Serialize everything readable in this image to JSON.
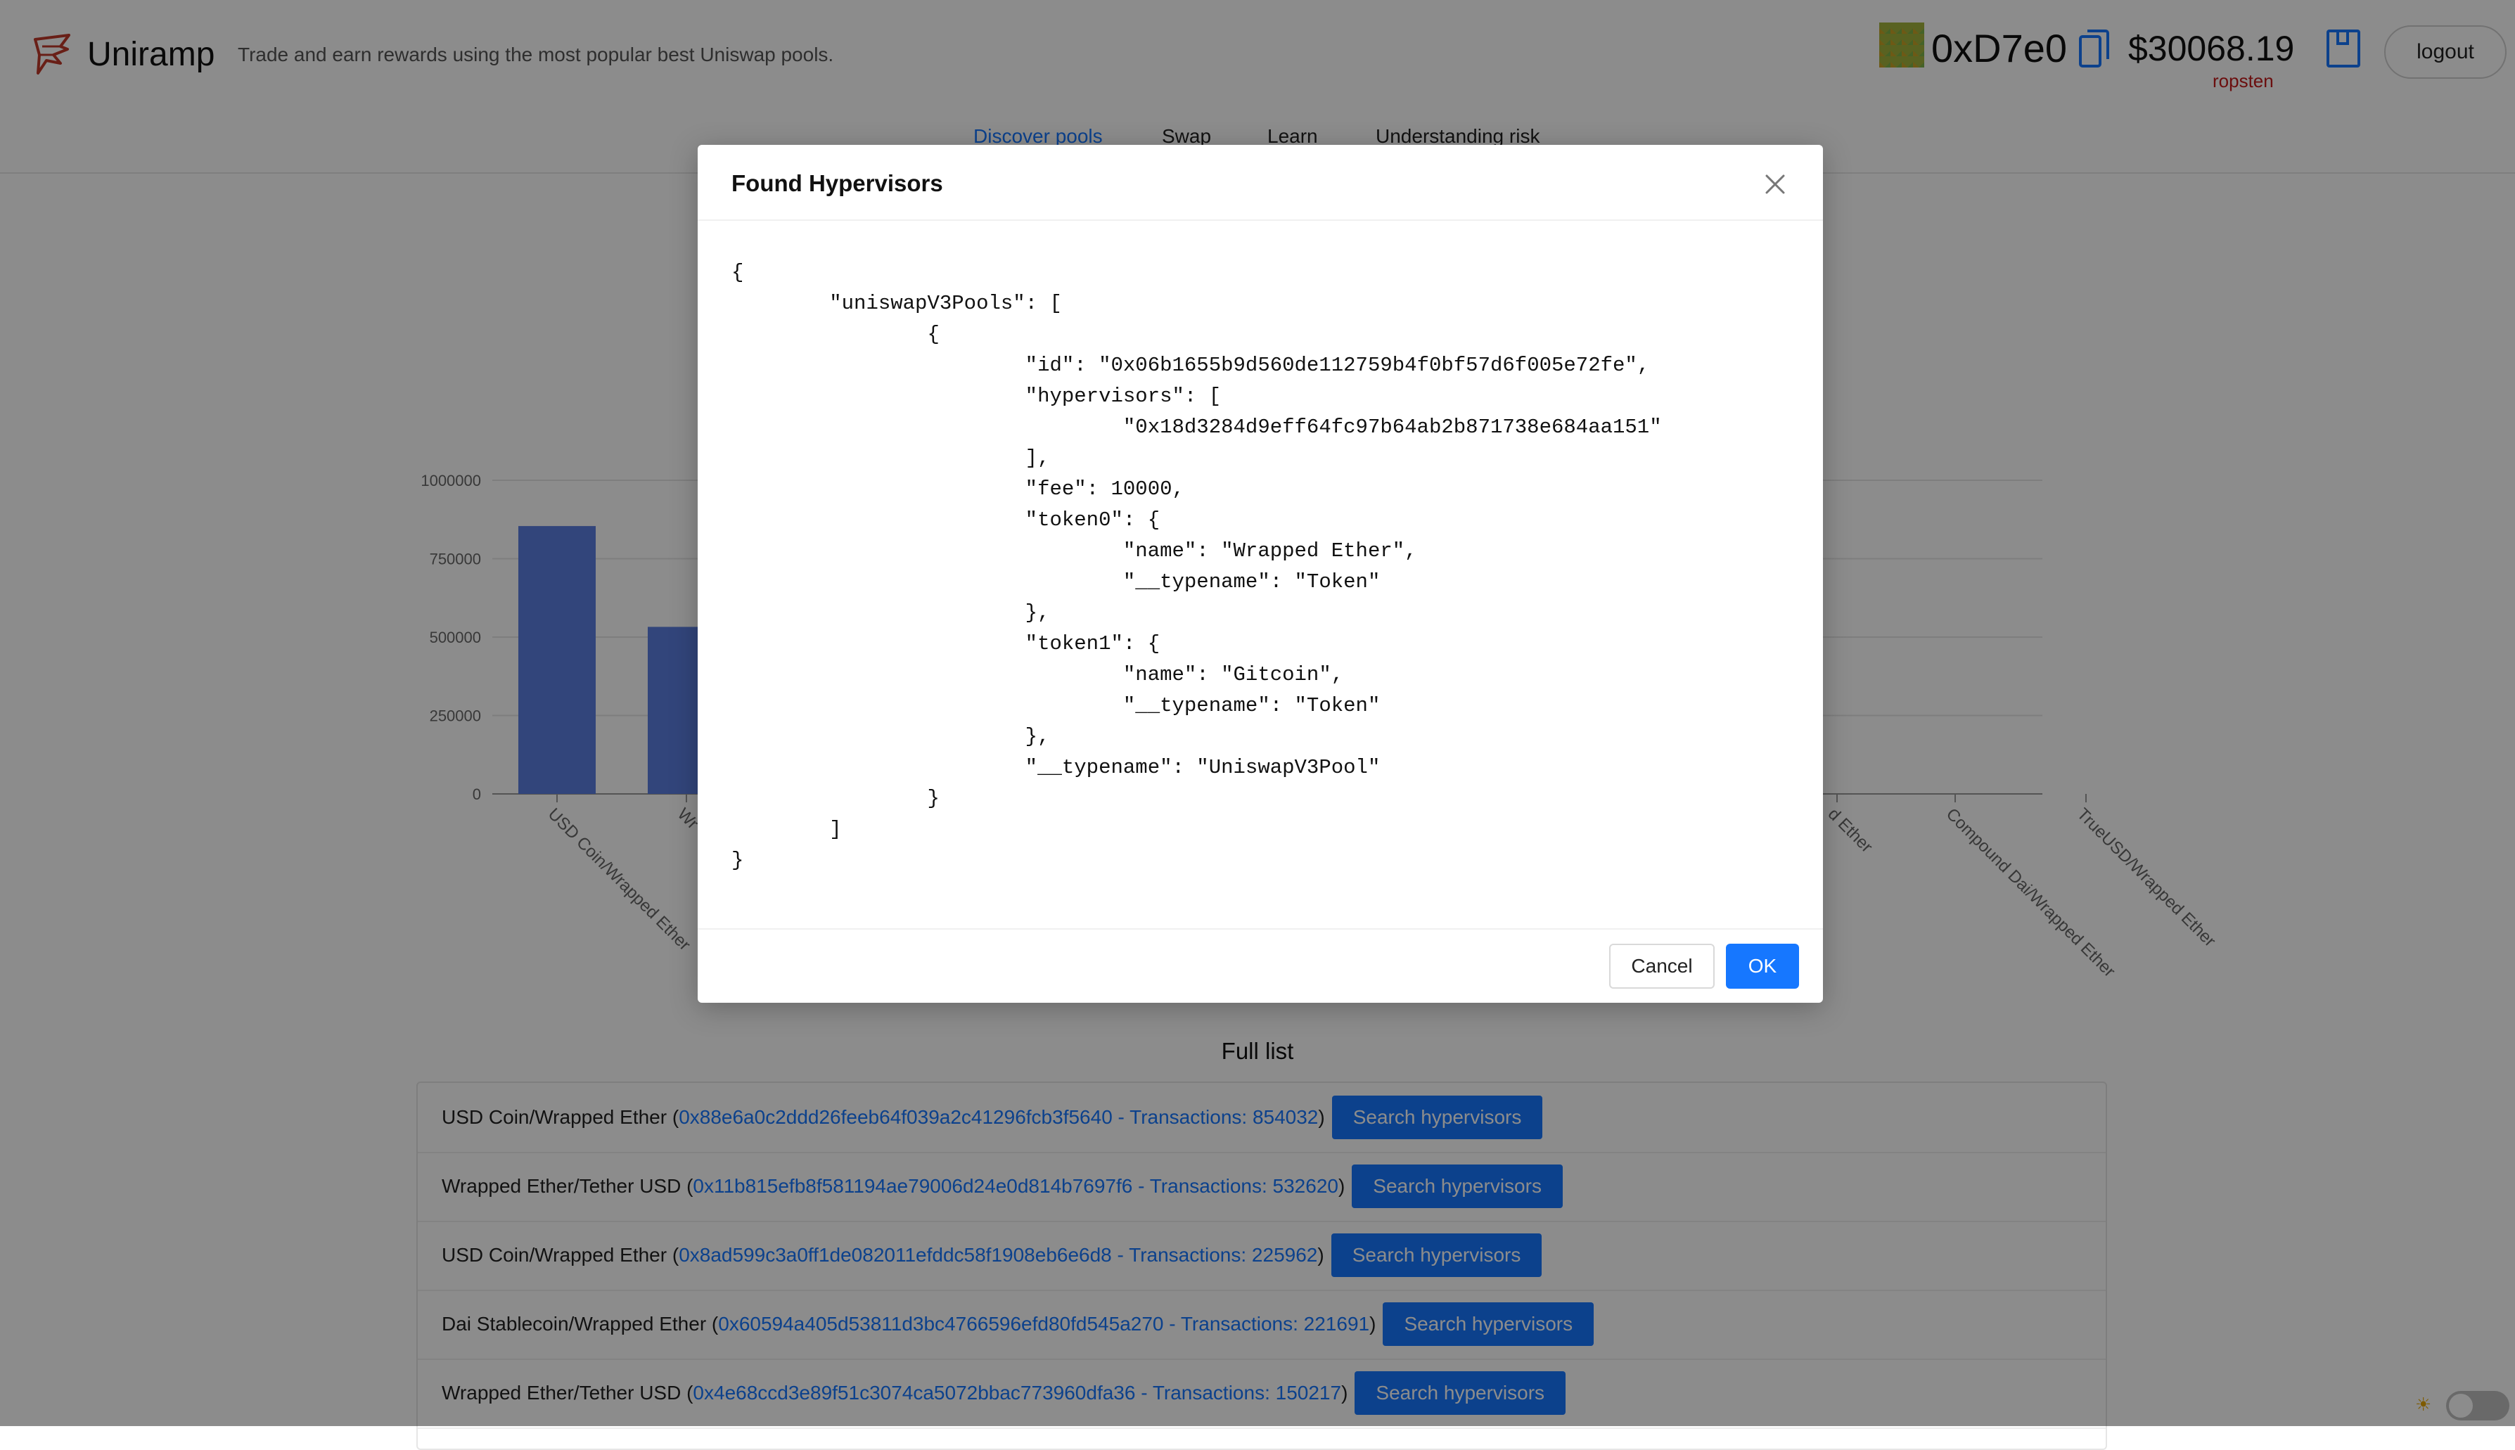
{
  "header": {
    "app_name": "Uniramp",
    "tagline": "Trade and earn rewards using the most popular best Uniswap pools.",
    "address": "0xD7e0",
    "balance": "$30068.19",
    "network": "ropsten",
    "logout_label": "logout",
    "nav": [
      {
        "label": "Discover pools",
        "active": true
      },
      {
        "label": "Swap",
        "active": false
      },
      {
        "label": "Learn",
        "active": false
      },
      {
        "label": "Understanding risk",
        "active": false
      }
    ]
  },
  "chart_data": {
    "type": "bar",
    "title": "",
    "xlabel": "",
    "ylabel": "",
    "ylim": [
      0,
      1000000
    ],
    "yticks": [
      "0",
      "250000",
      "500000",
      "750000",
      "1000000"
    ],
    "grid": true,
    "categories": [
      "USD Coin/Wrapped Ether",
      "Wr",
      "d Ether",
      "Compound Dai/Wrapped Ether",
      "TrueUSD/Wrapped Ether"
    ],
    "values": [
      854032,
      532620
    ]
  },
  "full_list": {
    "title": "Full list",
    "search_label": "Search hypervisors",
    "items": [
      {
        "name": "USD Coin/Wrapped Ether",
        "link": "0x88e6a0c2ddd26feeb64f039a2c41296fcb3f5640 - Transactions: 854032"
      },
      {
        "name": "Wrapped Ether/Tether USD",
        "link": "0x11b815efb8f581194ae79006d24e0d814b7697f6 - Transactions: 532620"
      },
      {
        "name": "USD Coin/Wrapped Ether",
        "link": "0x8ad599c3a0ff1de082011efddc58f1908eb6e6d8 - Transactions: 225962"
      },
      {
        "name": "Dai Stablecoin/Wrapped Ether",
        "link": "0x60594a405d53811d3bc4766596efd80fd545a270 - Transactions: 221691"
      },
      {
        "name": "Wrapped Ether/Tether USD",
        "link": "0x4e68ccd3e89f51c3074ca5072bbac773960dfa36 - Transactions: 150217"
      }
    ]
  },
  "modal": {
    "title": "Found Hypervisors",
    "json_text": "{\n\t\"uniswapV3Pools\": [\n\t\t{\n\t\t\t\"id\": \"0x06b1655b9d560de112759b4f0bf57d6f005e72fe\",\n\t\t\t\"hypervisors\": [\n\t\t\t\t\"0x18d3284d9eff64fc97b64ab2b871738e684aa151\"\n\t\t\t],\n\t\t\t\"fee\": 10000,\n\t\t\t\"token0\": {\n\t\t\t\t\"name\": \"Wrapped Ether\",\n\t\t\t\t\"__typename\": \"Token\"\n\t\t\t},\n\t\t\t\"token1\": {\n\t\t\t\t\"name\": \"Gitcoin\",\n\t\t\t\t\"__typename\": \"Token\"\n\t\t\t},\n\t\t\t\"__typename\": \"UniswapV3Pool\"\n\t\t}\n\t]\n}",
    "cancel_label": "Cancel",
    "ok_label": "OK"
  },
  "theme": {
    "sun_icon": "☀",
    "toggle_on": false
  },
  "colors": {
    "accent": "#1677ff",
    "bar": "#5b7fe0",
    "network": "#c41a1a"
  },
  "icons": {
    "logo": "bird-logo-icon",
    "copy": "copy-icon",
    "wallet": "wallet-icon",
    "close": "close-icon",
    "sun": "sun-icon"
  }
}
